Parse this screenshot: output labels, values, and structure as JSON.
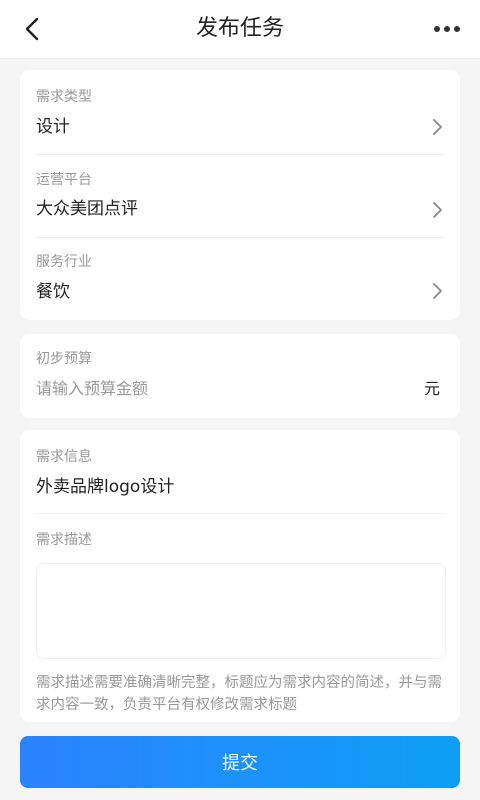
{
  "header": {
    "title": "发布任务",
    "back_icon": "chevron-left-icon",
    "more_icon": "more-dots-icon"
  },
  "basic": {
    "demand_type": {
      "label": "需求类型",
      "value": "设计"
    },
    "platform": {
      "label": "运营平台",
      "value": "大众美团点评"
    },
    "industry": {
      "label": "服务行业",
      "value": "餐饮"
    }
  },
  "budget": {
    "label": "初步预算",
    "placeholder": "请输入预算金额",
    "unit": "元"
  },
  "demand": {
    "info_label": "需求信息",
    "info_value": "外卖品牌logo设计",
    "desc_label": "需求描述",
    "desc_value": "",
    "hint": "需求描述需要准确清晰完整，标题应为需求内容的简述，并与需求内容一致，负责平台有权修改需求标题"
  },
  "footer": {
    "submit_label": "提交"
  },
  "colors": {
    "accent_start": "#2b83ff",
    "accent_end": "#0d9ff5",
    "background": "#f5f5f5"
  }
}
